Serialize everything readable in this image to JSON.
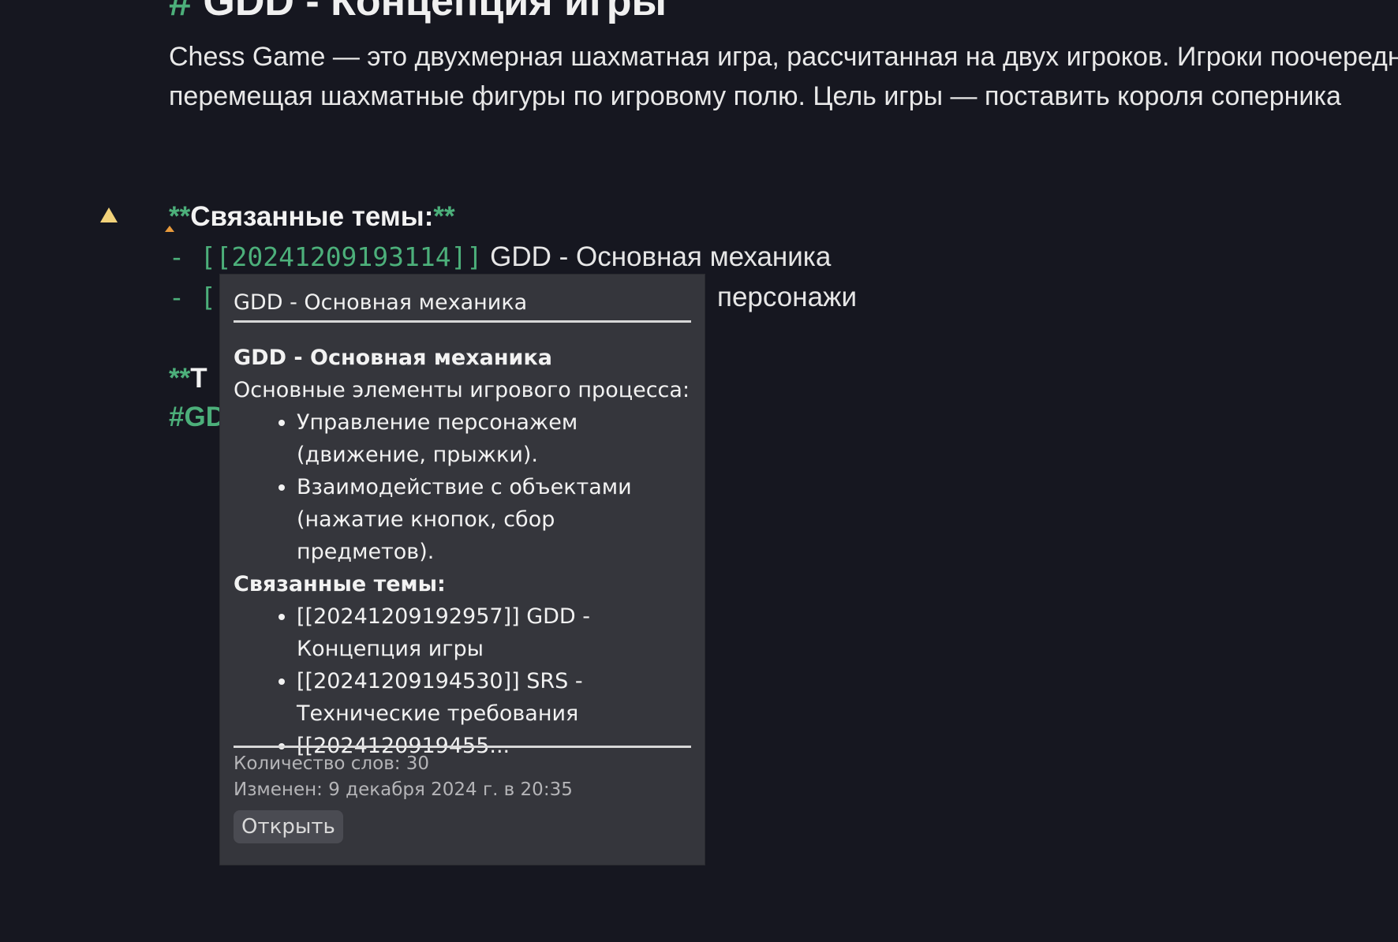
{
  "note": {
    "heading_hash": "#",
    "heading_text": "GDD - Концепция игры",
    "description_line1": "Chess Game — это двухмерная шахматная игра, рассчитанная на двух игроков. Игроки поочередно",
    "description_line2": "перемещая шахматные фигуры по игровому полю. Цель игры — поставить короля соперника",
    "related": {
      "open_md": "**",
      "label": "Связанные темы:",
      "close_md": "**"
    },
    "links": [
      {
        "prefix": "- [[",
        "id": "20241209193114",
        "suffix": "]]",
        "title": "GDD - Основная механика"
      },
      {
        "prefix": "- [[",
        "visible_tail": "персонажи"
      }
    ],
    "tags_section": {
      "open_md": "**",
      "label_partial": "Т"
    },
    "tag_partial": "#GD"
  },
  "popover": {
    "title": "GDD - Основная механика",
    "heading": "GDD - Основная механика",
    "intro": "Основные элементы игрового процесса:",
    "bullets": [
      "Управление персонажем (движение, прыжки).",
      "Взаимодействие с объектами (нажатие кнопок, сбор предметов)."
    ],
    "related_heading": "Связанные темы:",
    "related_items": [
      "[[20241209192957]] GDD - Концепция игры",
      "[[20241209194530]] SRS - Технические требования",
      "[[2024120919455..."
    ],
    "word_count": "Количество слов: 30",
    "modified": "Изменен: 9 декабря 2024 г. в 20:35",
    "open_button": "Открыть"
  },
  "colors": {
    "background": "#161720",
    "markdown_accent": "#4caf7a",
    "popover_bg": "#35363c",
    "warning": "#f2d27a"
  }
}
